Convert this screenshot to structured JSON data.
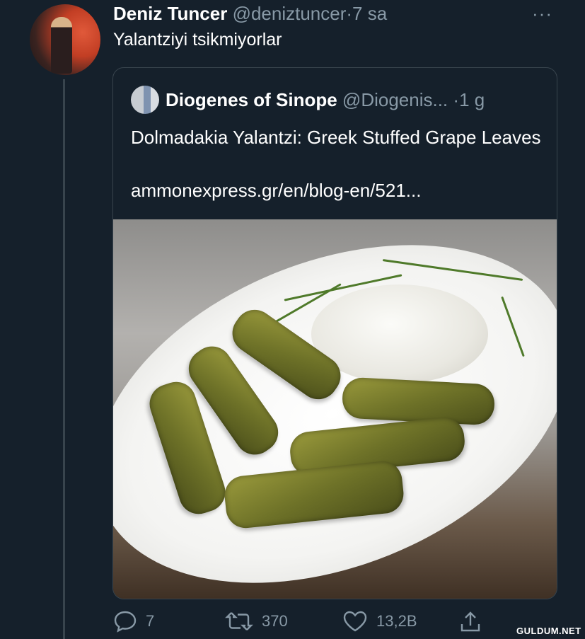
{
  "tweet": {
    "author_name": "Deniz Tuncer",
    "author_handle": "@deniztuncer",
    "separator": "·",
    "time": "7 sa",
    "text": "Yalantziyi tsikmiyorlar",
    "more_label": "···"
  },
  "quoted": {
    "author_name": "Diogenes of Sinope",
    "author_handle": "@Diogenis...",
    "separator": "·",
    "time": "1 g",
    "text": "Dolmadakia Yalantzi: Greek Stuffed Grape Leaves",
    "link": "ammonexpress.gr/en/blog-en/521..."
  },
  "actions": {
    "reply_count": "7",
    "retweet_count": "370",
    "like_count": "13,2B",
    "reply_icon": "reply-icon",
    "retweet_icon": "retweet-icon",
    "like_icon": "heart-icon",
    "share_icon": "share-icon"
  },
  "watermark": "GULDUM.NET",
  "colors": {
    "background": "#15202b",
    "secondary_text": "#8899a6",
    "border": "#38444d"
  }
}
